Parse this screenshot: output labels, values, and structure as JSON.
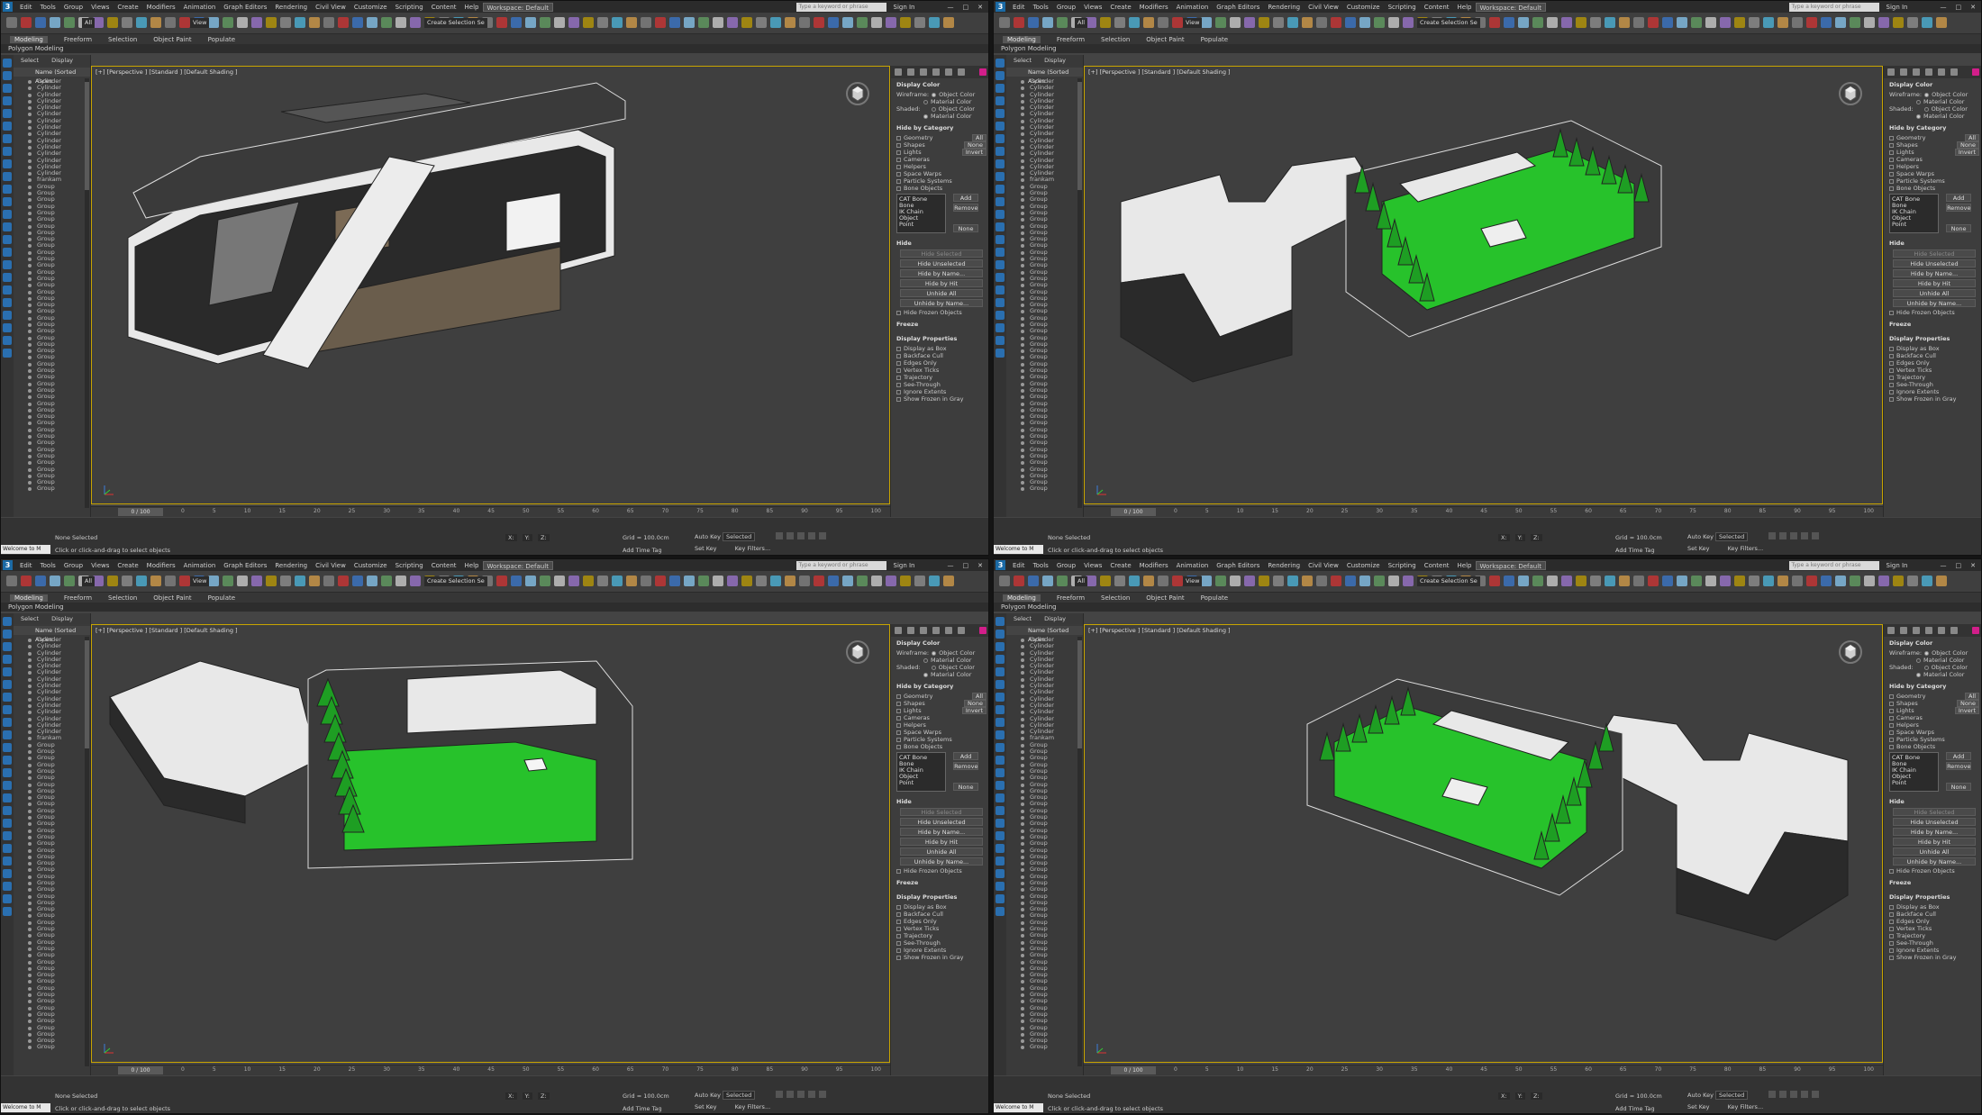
{
  "app": {
    "logo_text": "3",
    "workspace": "Workspace: Default",
    "menus": [
      "Edit",
      "Tools",
      "Group",
      "Views",
      "Create",
      "Modifiers",
      "Animation",
      "Graph Editors",
      "Rendering",
      "Civil View",
      "Customize",
      "Scripting",
      "Content",
      "Help"
    ],
    "search_placeholder": "Type a keyword or phrase",
    "sign_in": "Sign In",
    "window_buttons": [
      "—",
      "□",
      "✕"
    ]
  },
  "toolbar": {
    "filter_all": "All",
    "view_dropdown": "View",
    "create_selection_set": "Create Selection Se"
  },
  "ribbon": {
    "tabs": [
      "Modeling",
      "Freeform",
      "Selection",
      "Object Paint",
      "Populate"
    ],
    "active": "Modeling",
    "sub": "Polygon Modeling"
  },
  "explorer": {
    "tabs": [
      "Select",
      "Display"
    ],
    "header": "Name (Sorted Ascen",
    "rows": [
      "Cylinder",
      "Cylinder",
      "Cylinder",
      "Cylinder",
      "Cylinder",
      "Cylinder",
      "Cylinder",
      "Cylinder",
      "Cylinder",
      "Cylinder",
      "Cylinder",
      "Cylinder",
      "Cylinder",
      "Cylinder",
      "Cylinder",
      "frankam",
      "Group",
      "Group",
      "Group",
      "Group",
      "Group",
      "Group",
      "Group",
      "Group",
      "Group",
      "Group",
      "Group",
      "Group",
      "Group",
      "Group",
      "Group",
      "Group",
      "Group",
      "Group",
      "Group",
      "Group",
      "Group",
      "Group",
      "Group",
      "Group",
      "Group",
      "Group",
      "Group",
      "Group",
      "Group",
      "Group",
      "Group",
      "Group",
      "Group",
      "Group",
      "Group",
      "Group",
      "Group",
      "Group",
      "Group",
      "Group",
      "Group",
      "Group",
      "Group",
      "Group",
      "Group",
      "Group",
      "Group"
    ]
  },
  "viewport": {
    "label": "[+] [Perspective ] [Standard ] [Default Shading ]"
  },
  "command_panel": {
    "display_color": "Display Color",
    "wireframe_label": "Wireframe:",
    "shaded_label": "Shaded:",
    "object_color": "Object Color",
    "material_color": "Material Color",
    "hide_by_category": "Hide by Category",
    "categories": [
      "Geometry",
      "Shapes",
      "Lights",
      "Cameras",
      "Helpers",
      "Space Warps",
      "Particle Systems",
      "Bone Objects"
    ],
    "cat_buttons": [
      "All",
      "None",
      "Invert"
    ],
    "list_items": [
      "CAT Bone",
      "Bone",
      "IK Chain Object",
      "Point"
    ],
    "add": "Add",
    "remove": "Remove",
    "none": "None",
    "hide": "Hide",
    "hide_buttons": [
      "Hide Selected",
      "Hide Unselected",
      "Hide by Name...",
      "Hide by Hit",
      "Unhide All",
      "Unhide by Name..."
    ],
    "hide_frozen": "Hide Frozen Objects",
    "freeze": "Freeze",
    "display_properties": "Display Properties",
    "display_props": [
      "Display as Box",
      "Backface Cull",
      "Edges Only",
      "Vertex Ticks",
      "Trajectory",
      "See-Through",
      "Ignore Extents",
      "Show Frozen in Gray"
    ]
  },
  "timeline": {
    "slider": "0 / 100",
    "ticks": [
      "0",
      "5",
      "10",
      "15",
      "20",
      "25",
      "30",
      "35",
      "40",
      "45",
      "50",
      "55",
      "60",
      "65",
      "70",
      "75",
      "80",
      "85",
      "90",
      "95",
      "100"
    ]
  },
  "status": {
    "welcome": "Welcome to M",
    "none_selected": "None Selected",
    "hint": "Click or click-and-drag to select objects",
    "x": "X:",
    "y": "Y:",
    "z": "Z:",
    "grid": "Grid = 100.0cm",
    "add_time_tag": "Add Time Tag",
    "auto_key": "Auto Key",
    "set_key": "Set Key",
    "selected": "Selected",
    "key_filters": "Key Filters..."
  },
  "colors": {
    "accent_blue": "#1b6aa5",
    "selection_yellow": "#c8a400",
    "grass_green": "#27c22b",
    "pink_swatch": "#d21e8a"
  }
}
